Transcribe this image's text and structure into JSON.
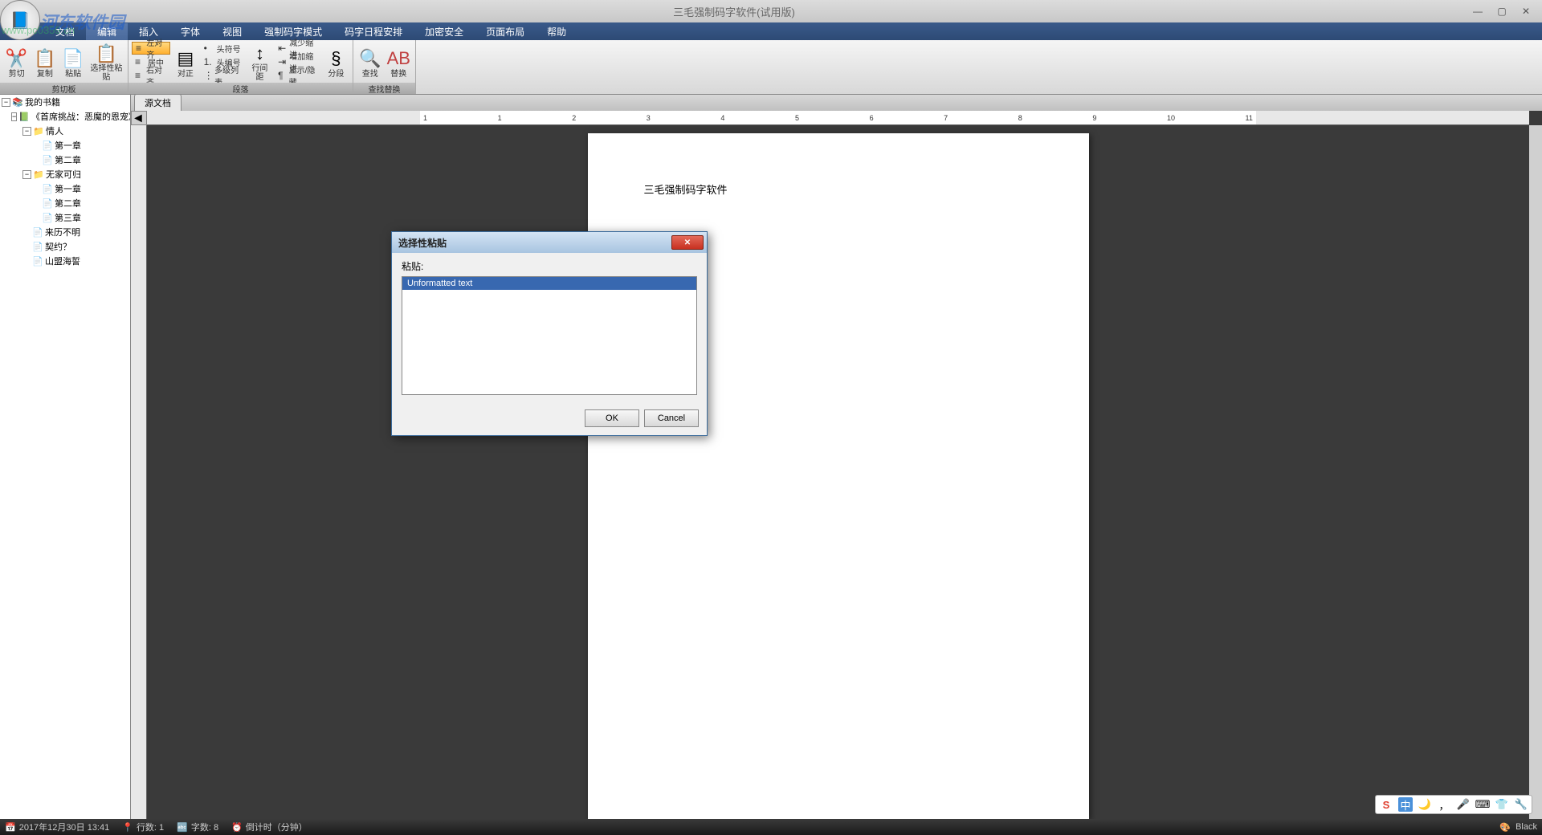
{
  "app": {
    "title": "三毛强制码字软件(试用版)",
    "watermark_site": "www.pc0359.cn",
    "watermark_brand": "河东软件园"
  },
  "menu": {
    "items": [
      "文档",
      "编辑",
      "插入",
      "字体",
      "视图",
      "强制码字模式",
      "码字日程安排",
      "加密安全",
      "页面布局",
      "帮助"
    ],
    "active_index": 1
  },
  "ribbon": {
    "clipboard": {
      "label": "剪切板",
      "cut": "剪切",
      "copy": "复制",
      "paste": "粘贴",
      "paste_special": "选择性粘贴"
    },
    "paragraph": {
      "label": "段落",
      "align_left": "左对齐",
      "align_center": "居中",
      "align_right": "右对齐",
      "align_both": "对正",
      "bullet": "头符号",
      "number": "头编号",
      "multilist": "多级列表",
      "line_spacing": "行间距",
      "decrease_indent": "减少缩进",
      "increase_indent": "增加缩进",
      "show_hide": "显示/隐藏",
      "section": "分段"
    },
    "find_replace": {
      "label": "查找替换",
      "find": "查找",
      "replace": "替换"
    }
  },
  "tree": {
    "root": "我的书籍",
    "book": "《首席挑战：恶魔的恩宠》",
    "nodes": [
      {
        "label": "情人",
        "children": [
          "第一章",
          "第二章"
        ]
      },
      {
        "label": "无家可归",
        "children": [
          "第一章",
          "第二章",
          "第三章"
        ]
      },
      {
        "label": "来历不明"
      },
      {
        "label": "契约？"
      },
      {
        "label": "山盟海誓"
      }
    ]
  },
  "editor": {
    "tab": "源文档",
    "page_text": "三毛强制码字软件"
  },
  "dialog": {
    "title": "选择性粘贴",
    "label": "粘贴:",
    "items": [
      "Unformatted text"
    ],
    "ok": "OK",
    "cancel": "Cancel"
  },
  "status": {
    "datetime": "2017年12月30日 13:41",
    "line": "行数: 1",
    "words": "字数: 8",
    "countdown": "倒计时（分钟）",
    "theme": "Black"
  },
  "ime": {
    "lang": "中"
  },
  "ruler_numbers": [
    "1",
    "",
    "1",
    "2",
    "3",
    "4",
    "5",
    "6",
    "7",
    "8",
    "9",
    "10",
    "11"
  ]
}
